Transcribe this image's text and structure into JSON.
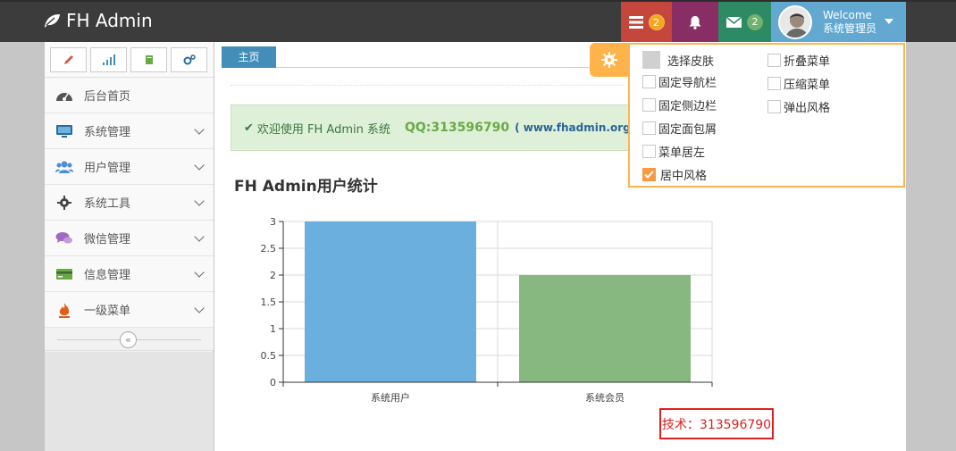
{
  "navbar": {
    "brand": "FH Admin",
    "tasks_count": "2",
    "messages_count": "2",
    "user": {
      "welcome": "Welcome",
      "name": "系统管理员"
    }
  },
  "sidebar": {
    "items": [
      {
        "label": "后台首页",
        "icon": "dashboard-icon",
        "color": "#555555",
        "chevron": false
      },
      {
        "label": "系统管理",
        "icon": "desktop-icon",
        "color": "#2c6aa0",
        "chevron": true
      },
      {
        "label": "用户管理",
        "icon": "users-icon",
        "color": "#4f8fd1",
        "chevron": true
      },
      {
        "label": "系统工具",
        "icon": "cog-icon",
        "color": "#444444",
        "chevron": true
      },
      {
        "label": "微信管理",
        "icon": "comments-icon",
        "color": "#a069c3",
        "chevron": true
      },
      {
        "label": "信息管理",
        "icon": "credit-card-icon",
        "color": "#69aa46",
        "chevron": true
      },
      {
        "label": "一级菜单",
        "icon": "fire-icon",
        "color": "#e25d1c",
        "chevron": true
      }
    ]
  },
  "tabs": [
    {
      "label": "主页"
    }
  ],
  "alert": {
    "text": "欢迎使用 FH Admin 系统",
    "qq": "QQ:313596790",
    "site": "( www.fhadmin.org"
  },
  "section_title": "FH Admin用户统计",
  "chart_data": {
    "type": "bar",
    "categories": [
      "系统用户",
      "系统会员"
    ],
    "values": [
      3,
      2
    ],
    "colors": [
      "#6aafde",
      "#87b87f"
    ],
    "ylim": [
      0,
      3
    ],
    "yticks": [
      "0",
      "0.5",
      "1",
      "1.5",
      "2",
      "2.5",
      "3"
    ],
    "grid": true
  },
  "tech_note": "技术：313596790",
  "settings": {
    "skin_label": "选择皮肤",
    "options_left": [
      {
        "label": "固定导航栏",
        "checked": false
      },
      {
        "label": "固定侧边栏",
        "checked": false
      },
      {
        "label": "固定面包屑",
        "checked": false
      },
      {
        "label": "菜单居左",
        "checked": false
      },
      {
        "label": "居中风格",
        "checked": true
      }
    ],
    "options_right": [
      {
        "label": "折叠菜单",
        "checked": false
      },
      {
        "label": "压缩菜单",
        "checked": false
      },
      {
        "label": "弹出风格",
        "checked": false
      }
    ]
  }
}
